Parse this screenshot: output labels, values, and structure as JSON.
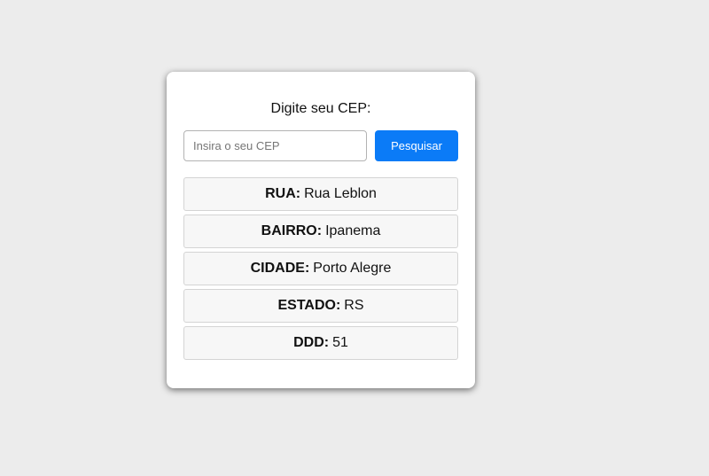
{
  "form": {
    "prompt": "Digite seu CEP:",
    "input_value": "",
    "input_placeholder": "Insira o seu CEP",
    "search_button_label": "Pesquisar",
    "accent_color": "#0b7bf7"
  },
  "results": [
    {
      "label": "RUA:",
      "value": "Rua Leblon"
    },
    {
      "label": "BAIRRO:",
      "value": "Ipanema"
    },
    {
      "label": "CIDADE:",
      "value": "Porto Alegre"
    },
    {
      "label": "ESTADO:",
      "value": "RS"
    },
    {
      "label": "DDD:",
      "value": "51"
    }
  ]
}
